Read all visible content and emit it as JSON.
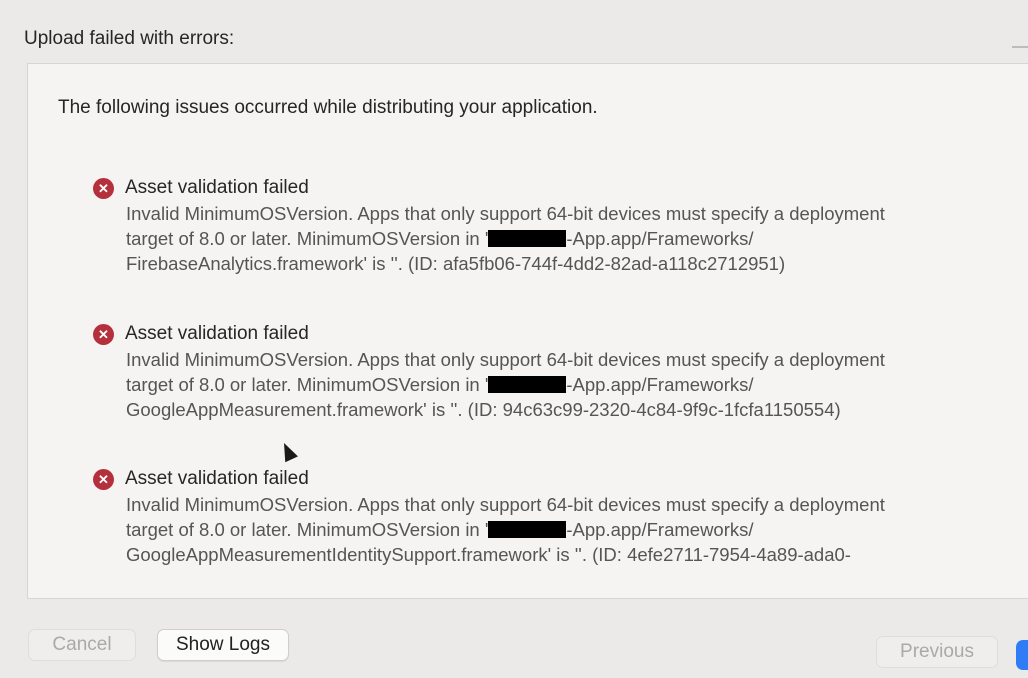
{
  "dialog": {
    "heading": "Upload failed with errors:",
    "intro": "The following issues occurred while distributing your application."
  },
  "issues": [
    {
      "title": "Asset validation failed",
      "line1": "Invalid MinimumOSVersion. Apps that only support 64-bit devices must specify a deployment",
      "line2_pre": "target of 8.0 or later. MinimumOSVersion in '",
      "line2_post": "-App.app/Frameworks/",
      "line3": "FirebaseAnalytics.framework' is ''. (ID: afa5fb06-744f-4dd2-82ad-a118c2712951)"
    },
    {
      "title": "Asset validation failed",
      "line1": "Invalid MinimumOSVersion. Apps that only support 64-bit devices must specify a deployment",
      "line2_pre": "target of 8.0 or later. MinimumOSVersion in '",
      "line2_post": "-App.app/Frameworks/",
      "line3": "GoogleAppMeasurement.framework' is ''. (ID: 94c63c99-2320-4c84-9f9c-1fcfa1150554)"
    },
    {
      "title": "Asset validation failed",
      "line1": "Invalid MinimumOSVersion. Apps that only support 64-bit devices must specify a deployment",
      "line2_pre": "target of 8.0 or later. MinimumOSVersion in '",
      "line2_post": "-App.app/Frameworks/",
      "line3": "GoogleAppMeasurementIdentitySupport.framework' is ''. (ID: 4efe2711-7954-4a89-ada0-"
    }
  ],
  "icons": {
    "error": "error-x-circle-icon",
    "error_glyph": "✕",
    "error_color": "#b5303d"
  },
  "buttons": {
    "cancel": "Cancel",
    "show_logs": "Show Logs",
    "previous": "Previous"
  },
  "colors": {
    "accent": "#2f7cf6"
  }
}
